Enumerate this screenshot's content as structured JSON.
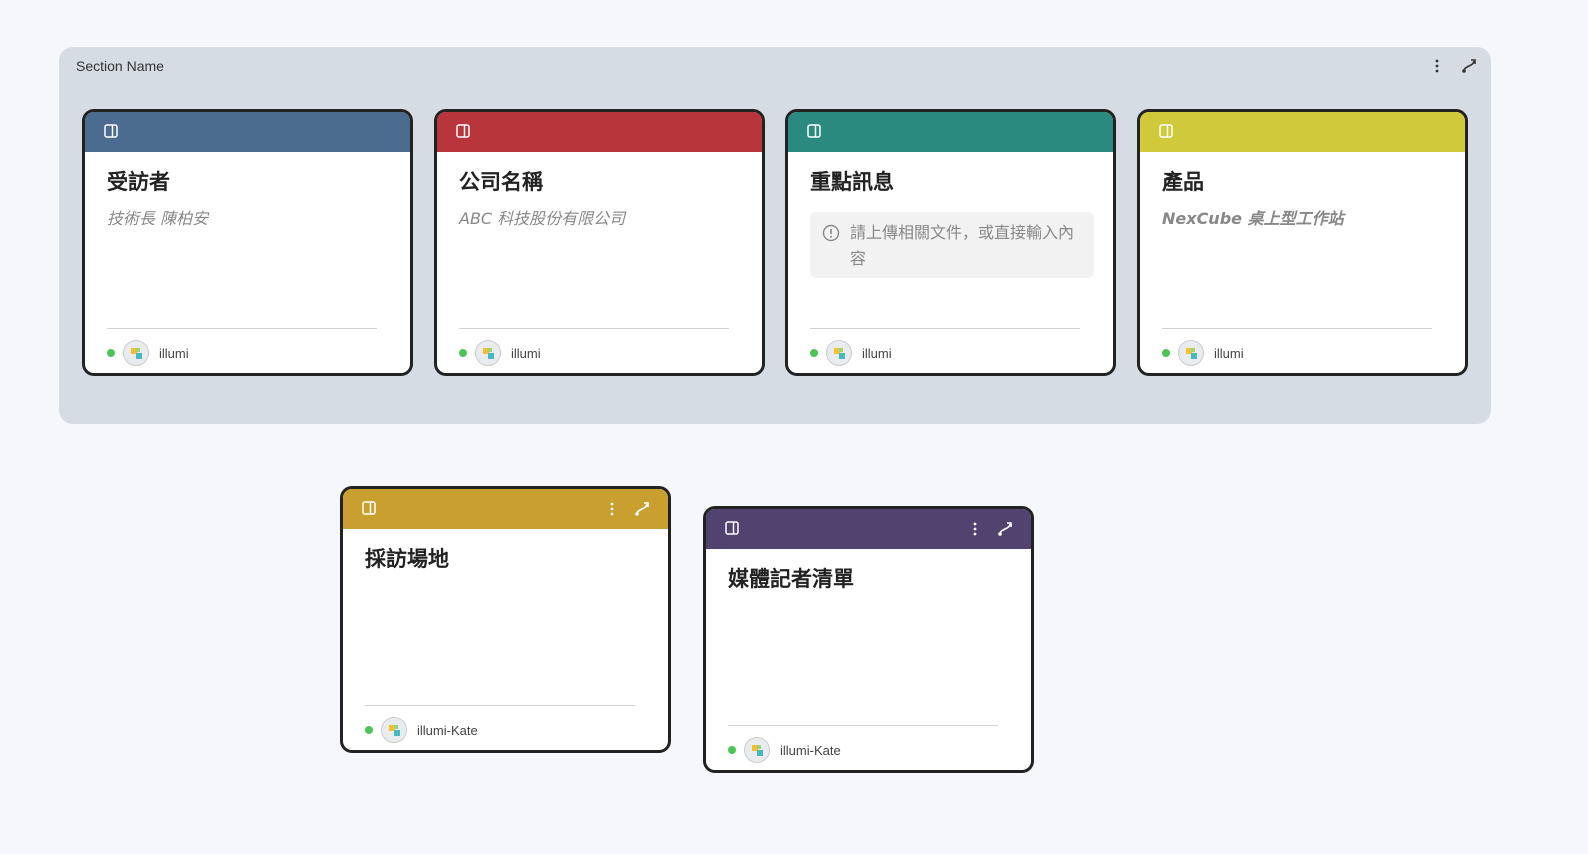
{
  "section": {
    "title": "Section Name",
    "icons": [
      "more-vertical-icon",
      "connector-icon"
    ]
  },
  "cards": [
    {
      "color": "#4b6b8f",
      "title": "受訪者",
      "subtitle": "技術長 陳柏安",
      "author": "illumi"
    },
    {
      "color": "#b8353c",
      "title": "公司名稱",
      "subtitle": "ABC 科技股份有限公司",
      "author": "illumi"
    },
    {
      "color": "#2a8a80",
      "title": "重點訊息",
      "notice": "請上傳相關文件，或直接輸入內容",
      "author": "illumi"
    },
    {
      "color": "#d0c93a",
      "title": "產品",
      "subtitle": "NexCube 桌上型工作站",
      "author": "illumi"
    },
    {
      "color": "#c9a030",
      "title": "採訪場地",
      "author": "illumi-Kate"
    },
    {
      "color": "#52426f",
      "title": "媒體記者清單",
      "author": "illumi-Kate"
    }
  ]
}
